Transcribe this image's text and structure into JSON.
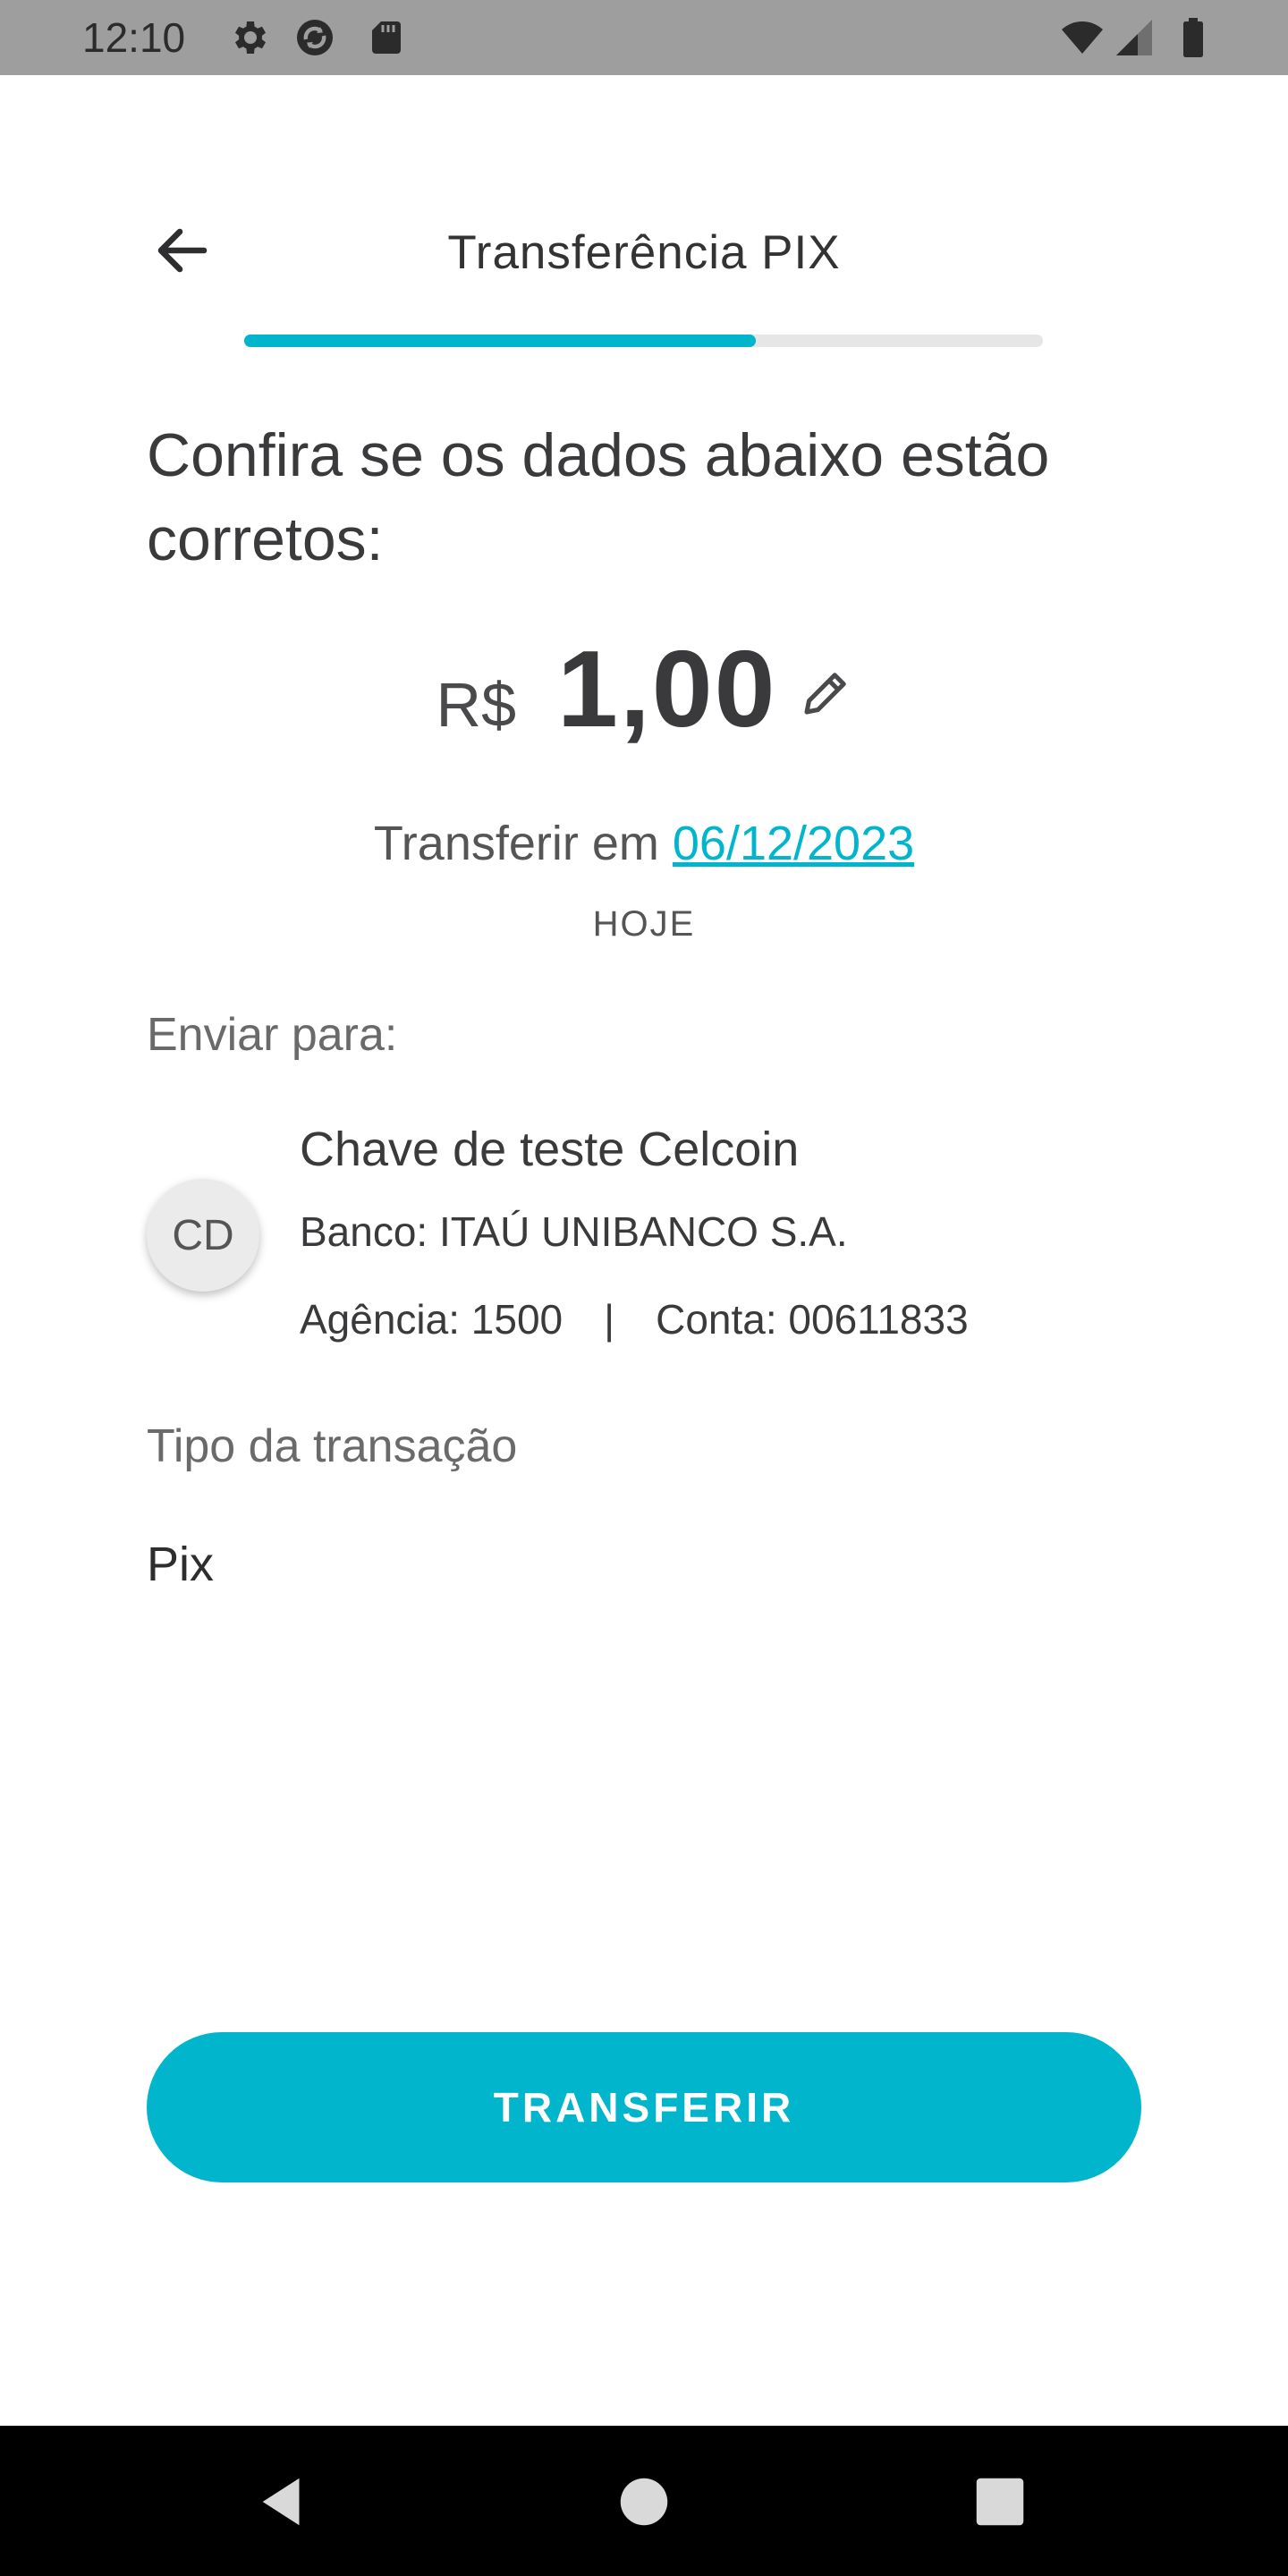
{
  "status_bar": {
    "time": "12:10",
    "icons": [
      "gear-icon",
      "sync-icon",
      "sd-card-icon",
      "wifi-icon",
      "signal-icon",
      "battery-icon"
    ]
  },
  "header": {
    "title": "Transferência PIX",
    "progress": 0.64
  },
  "content": {
    "heading": "Confira se os dados abaixo estão corretos:",
    "currency": "R$",
    "amount": "1,00",
    "date_prefix": "Transferir em",
    "date": "06/12/2023",
    "date_note": "HOJE",
    "send_to_label": "Enviar para:",
    "recipient": {
      "initials": "CD",
      "name": "Chave de teste Celcoin",
      "bank": "Banco: ITAÚ UNIBANCO S.A.",
      "agency": "Agência: 1500",
      "separator": "|",
      "account": "Conta: 00611833"
    },
    "transaction_type_label": "Tipo da transação",
    "transaction_type_value": "Pix"
  },
  "actions": {
    "transfer_label": "TRANSFERIR"
  },
  "colors": {
    "accent": "#00b5cc",
    "status_bar": "#9e9e9e",
    "nav_bar": "#000000"
  }
}
